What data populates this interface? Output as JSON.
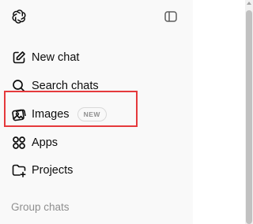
{
  "sidebar": {
    "logo": "openai-logo",
    "toggle_icon": "sidebar-toggle-icon",
    "items": [
      {
        "label": "New chat",
        "icon": "edit-icon"
      },
      {
        "label": "Search chats",
        "icon": "search-icon"
      },
      {
        "label": "Images",
        "icon": "images-icon",
        "badge": "NEW"
      },
      {
        "label": "Apps",
        "icon": "apps-icon"
      },
      {
        "label": "Projects",
        "icon": "folder-plus-icon"
      }
    ],
    "section_title": "Group chats"
  },
  "colors": {
    "highlight": "#e5393c",
    "sidebar_bg": "#f9f9f9",
    "muted_text": "#8f8f8f"
  }
}
